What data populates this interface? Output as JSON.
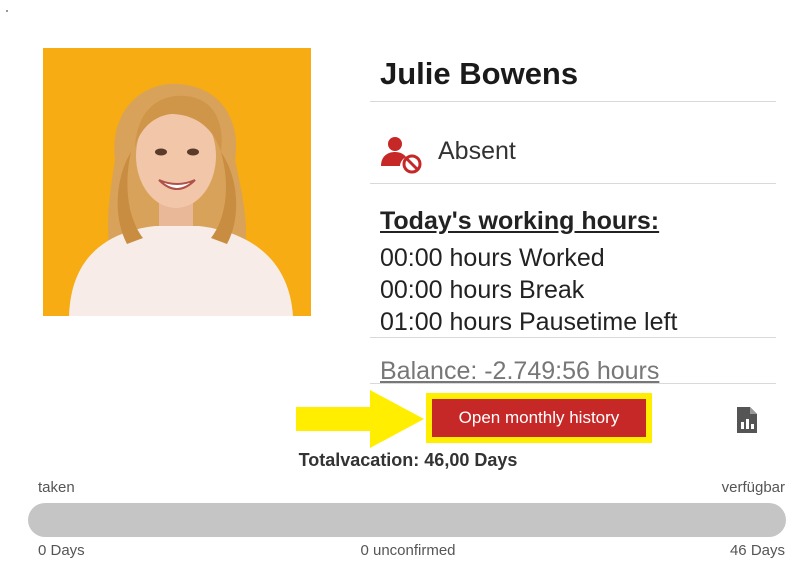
{
  "profile": {
    "name": "Julie Bowens",
    "status": "Absent",
    "status_icon": "user-absent-icon",
    "status_color": "#c62828"
  },
  "working_hours": {
    "title": "Today's working hours:",
    "lines": [
      "00:00 hours Worked",
      "00:00 hours Break",
      "01:00 hours Pausetime left"
    ],
    "balance": "Balance: -2.749:56 hours"
  },
  "actions": {
    "monthly_history_label": "Open monthly history",
    "report_icon": "report-document-icon",
    "highlight_color": "#ffee00",
    "button_color": "#c62828"
  },
  "vacation": {
    "total": "Totalvacation: 46,00 Days",
    "taken_label": "taken",
    "available_label": "verfügbar",
    "taken_value": "0 Days",
    "unconfirmed_value": "0 unconfirmed",
    "available_value": "46 Days",
    "progress_fraction": 0
  }
}
